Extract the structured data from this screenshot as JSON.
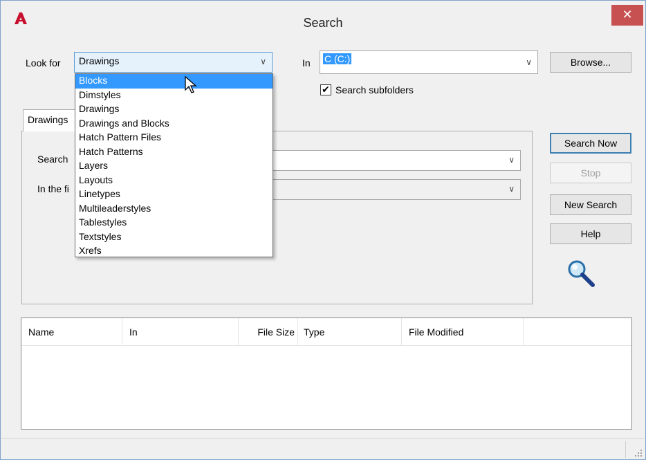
{
  "window": {
    "title": "Search",
    "close_label": "✕"
  },
  "look_for": {
    "label": "Look for",
    "value": "Drawings",
    "options": [
      "Blocks",
      "Dimstyles",
      "Drawings",
      "Drawings and Blocks",
      "Hatch Pattern Files",
      "Hatch Patterns",
      "Layers",
      "Layouts",
      "Linetypes",
      "Multileaderstyles",
      "Tablestyles",
      "Textstyles",
      "Xrefs"
    ],
    "highlighted": "Blocks"
  },
  "in_field": {
    "label": "In",
    "value": "C (C:)"
  },
  "browse_label": "Browse...",
  "search_subfolders": {
    "label": "Search subfolders",
    "checked": true
  },
  "tab": {
    "label": "Drawings"
  },
  "panel": {
    "search_label": "Search",
    "in_field_label": "In the fi"
  },
  "buttons": {
    "search_now": "Search Now",
    "stop": "Stop",
    "new_search": "New Search",
    "help": "Help"
  },
  "results": {
    "columns": [
      "Name",
      "In",
      "File Size",
      "Type",
      "File Modified"
    ]
  },
  "colors": {
    "accent": "#3399ff",
    "close": "#c75050"
  }
}
